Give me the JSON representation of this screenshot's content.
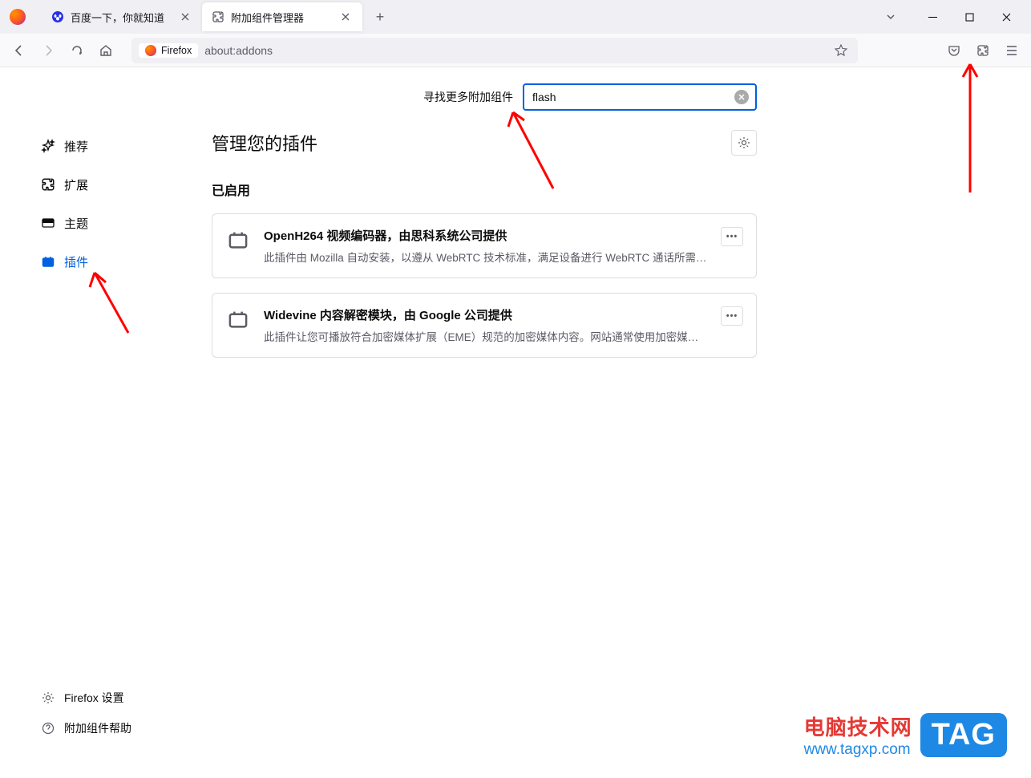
{
  "tabs": [
    {
      "title": "百度一下，你就知道",
      "icon": "baidu"
    },
    {
      "title": "附加组件管理器",
      "icon": "puzzle",
      "active": true
    }
  ],
  "url": {
    "identity": "Firefox",
    "value": "about:addons"
  },
  "sidebar": {
    "items": [
      {
        "label": "推荐",
        "icon": "sparkle"
      },
      {
        "label": "扩展",
        "icon": "puzzle"
      },
      {
        "label": "主题",
        "icon": "theme"
      },
      {
        "label": "插件",
        "icon": "plugin",
        "active": true
      }
    ],
    "bottom": [
      {
        "label": "Firefox 设置",
        "icon": "gear"
      },
      {
        "label": "附加组件帮助",
        "icon": "help"
      }
    ]
  },
  "search": {
    "label": "寻找更多附加组件",
    "value": "flash"
  },
  "main": {
    "title": "管理您的插件",
    "section": "已启用",
    "plugins": [
      {
        "title": "OpenH264 视频编码器，由思科系统公司提供",
        "desc": "此插件由 Mozilla 自动安装，以遵从 WebRTC 技术标准，满足设备进行 WebRTC 通话所需…"
      },
      {
        "title": "Widevine 内容解密模块，由 Google 公司提供",
        "desc": "此插件让您可播放符合加密媒体扩展（EME）规范的加密媒体内容。网站通常使用加密媒体…"
      }
    ]
  },
  "watermark": {
    "cn": "电脑技术网",
    "url": "www.tagxp.com",
    "tag": "TAG"
  }
}
